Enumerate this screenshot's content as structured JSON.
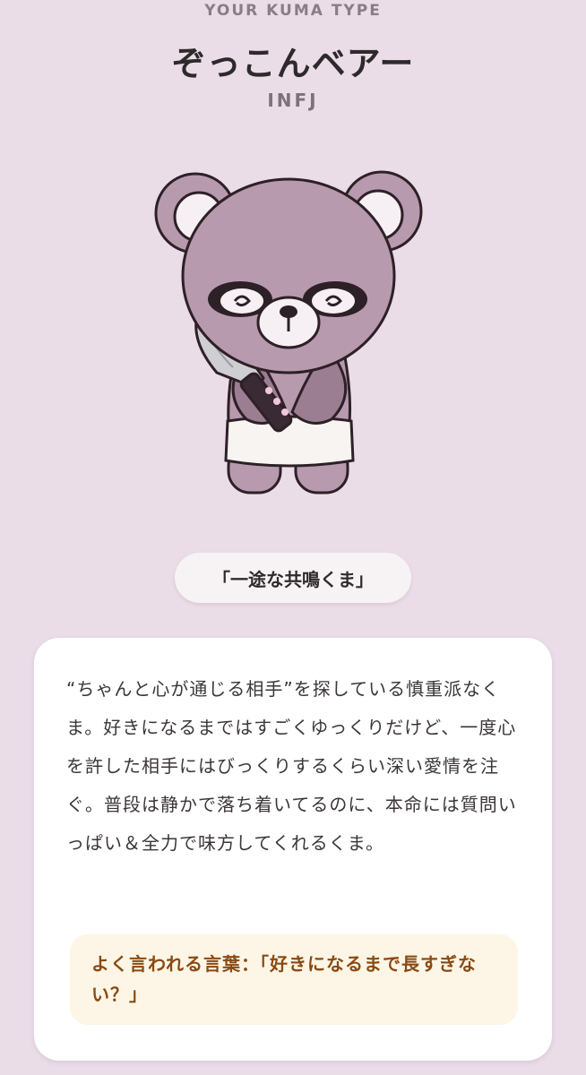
{
  "header": {
    "eyebrow": "YOUR KUMA TYPE",
    "title": "ぞっこんベアー",
    "type_code": "INFJ"
  },
  "catchphrase": "「一途な共鳴くま」",
  "card": {
    "description": "“ちゃんと心が通じる相手”を探している慎重派なくま。好きになるまではすごくゆっくりだけど、一度心を許した相手にはびっくりするくらい深い愛情を注ぐ。普段は静かで落ち着いてるのに、本命には質問いっぱい＆全力で味方してくれるくま。",
    "quote": "よく言われる言葉：「好きになるまで長すぎない？」"
  },
  "illustration": {
    "subject": "purple bear holding knife",
    "colors": {
      "fur": "#b89aae",
      "fur_dark": "#9c7e93",
      "outline": "#2d2026",
      "ear_inner": "#f6f0f4",
      "shorts": "#f8f4f2",
      "blade": "#cfcfd3",
      "handle": "#3a2a33"
    }
  },
  "theme": {
    "background": "#eadde8",
    "card": "#ffffff",
    "quote_bg": "#fdf6e6",
    "quote_text": "#8a4a12"
  }
}
